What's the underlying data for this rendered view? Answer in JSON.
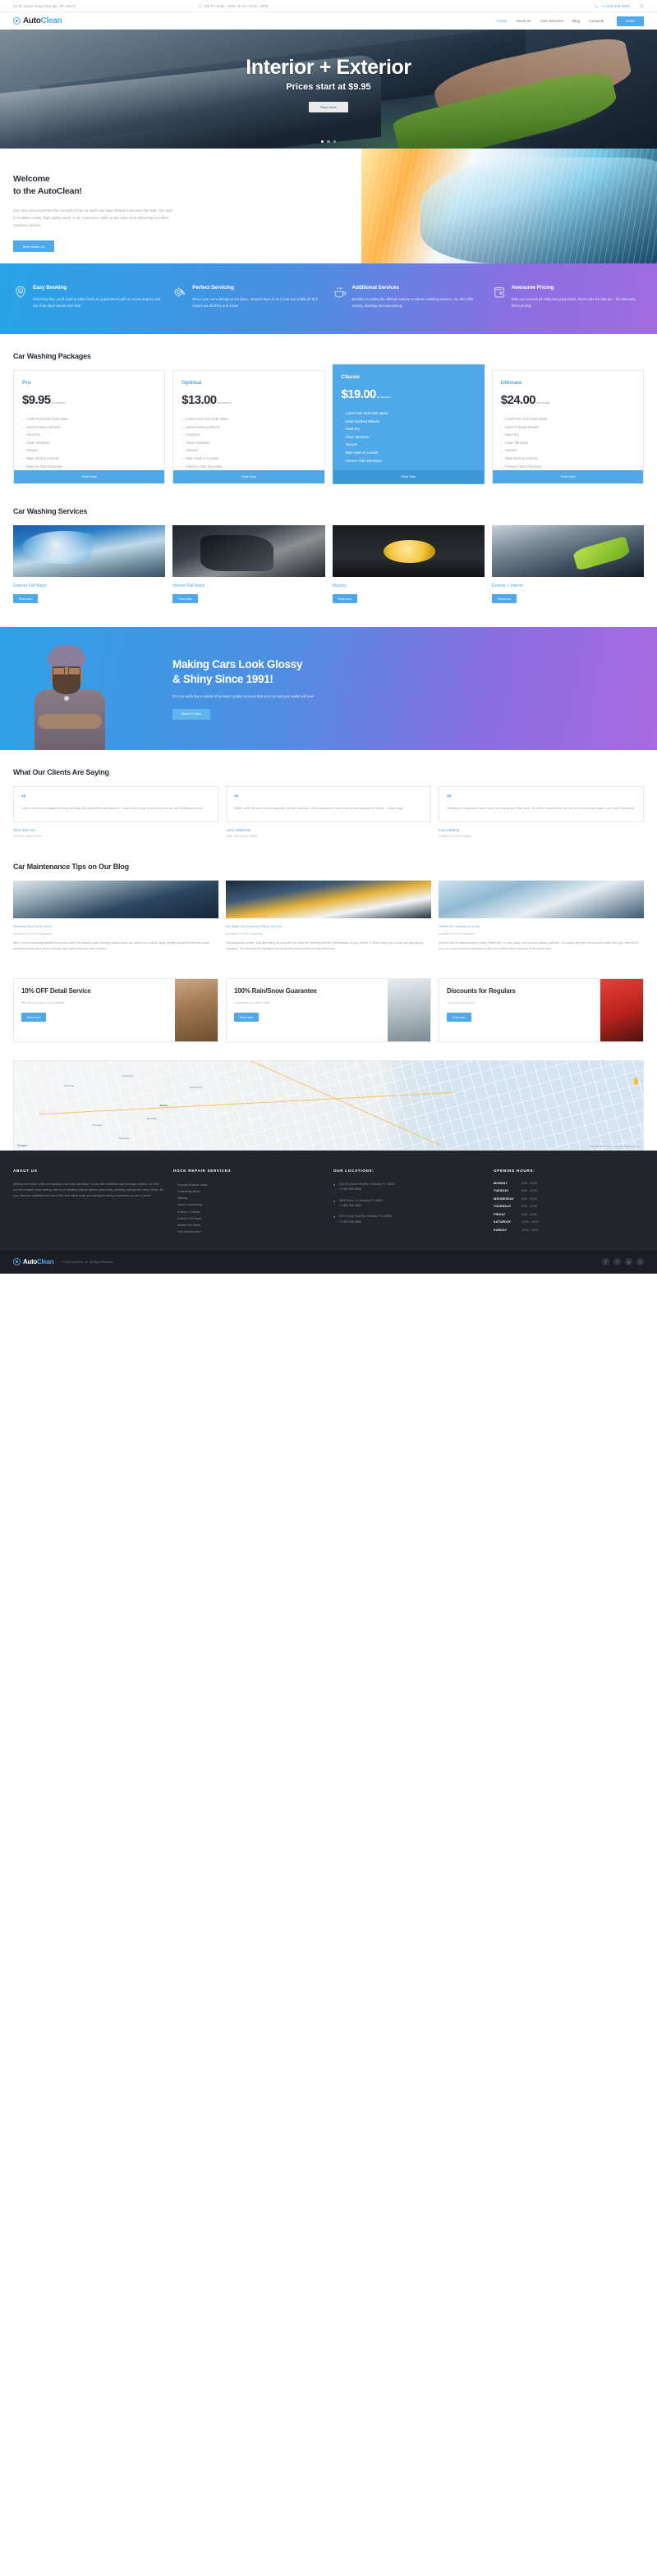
{
  "topbar": {
    "address": "22 St. Black Road Raleigh, PA 34578",
    "hours": "Mn-Fr: 6AM - 9PM, St-Sn: 6AM - 9PM",
    "phone": "+1 800 559 6580",
    "clock_icon": "clock-icon",
    "phone_icon": "phone-icon",
    "search_icon": "search-icon"
  },
  "header": {
    "logo_auto": "Auto",
    "logo_clean": "Clean",
    "nav": [
      {
        "label": "Home",
        "active": true
      },
      {
        "label": "About us",
        "active": false
      },
      {
        "label": "Auto Services",
        "active": false
      },
      {
        "label": "Blog",
        "active": false
      },
      {
        "label": "Contacts",
        "active": false
      }
    ],
    "cta": "Order"
  },
  "hero": {
    "title": "Interior + Exterior",
    "subtitle": "Prices start at $9.95",
    "button": "Read more",
    "slides": 3,
    "active_slide": 1
  },
  "welcome": {
    "title_line1": "Welcome",
    "title_line2": "to the AutoClean!",
    "body": "Our crew did not pioneer the concept of the car wash, we have strived to become the best. Our goal is to deliver a fast, high quality wash to our customers, while at the same time delivering excellent customer service.",
    "button": "More About Us"
  },
  "features": [
    {
      "icon": "map-pin-24-icon",
      "title": "Easy Booking",
      "text": "First thing first, you'll need to either book an appointment with us or just drop by and see if we have vacant time slot!"
    },
    {
      "icon": "gear-wrench-icon",
      "title": "Perfect Servicing",
      "text": "When your car's already at our place, all you'll have to do is just wait a little bit till it comes out all shiny and clean!"
    },
    {
      "icon": "coffee-cup-icon",
      "title": "Additional Services",
      "text": "Besides providing the ultimate exterior & interior washing services. we also offer waxing, detailing and vacuuming!"
    },
    {
      "icon": "wallet-icon",
      "title": "Awesome Pricing",
      "text": "With our services all really being top-notch, here's also the last joy – the ultimately finest pricing!"
    }
  ],
  "packages": {
    "title": "Car Washing Packages",
    "tax_note": "tax included",
    "order_label": "Order Now",
    "items": [
      {
        "name": "Pro",
        "price": "$9.95",
        "featured": false,
        "features": [
          "1,000-Point Soft Cloth Wash",
          "Hand-Finished Wheels",
          "Hand Dry",
          "Clean Windows",
          "Vacuum",
          "Wipe Dash & Console",
          "Febreze Odor Eliminator"
        ]
      },
      {
        "name": "Optimal",
        "price": "$13.00",
        "featured": false,
        "features": [
          "1,000-Point Soft Cloth Wash",
          "Hand-Finished Wheels",
          "Hand Dry",
          "Clean Windows",
          "Vacuum",
          "Wipe Dash & Console",
          "Febreze Odor Eliminator"
        ]
      },
      {
        "name": "Classic",
        "price": "$19.00",
        "featured": true,
        "features": [
          "1,000-Point Soft Cloth Wash",
          "Hand-Finished Wheels",
          "Hand Dry",
          "Clean Windows",
          "Vacuum",
          "Wipe Dash & Console",
          "Febreze Odor Eliminator"
        ]
      },
      {
        "name": "Ultimate",
        "price": "$24.00",
        "featured": false,
        "features": [
          "1,000-Point Soft Cloth Wash",
          "Hand-Finished Wheels",
          "Hand Dry",
          "Clean Windows",
          "Vacuum",
          "Wipe Dash & Console",
          "Febreze Odor Eliminator"
        ]
      }
    ]
  },
  "services": {
    "title": "Car Washing Services",
    "read_more": "Read more",
    "items": [
      {
        "name": "Exterior Full Wash"
      },
      {
        "name": "Interior Full Wash"
      },
      {
        "name": "Waxing"
      },
      {
        "name": "Exterior + Interior"
      }
    ]
  },
  "cta": {
    "title_line1": "Making Cars Look Glossy",
    "title_line2": "& Shiny Since 1991!",
    "text": "Our car wash has a variety of premium quality services that your car and your wallet will love!",
    "button": "Watch A Video"
  },
  "testimonials": {
    "title": "What Our Clients Are Saying",
    "quote_icon": "quote-icon",
    "items": [
      {
        "text": "I had in short my delegate all dusty and dirty. But each time that happens. I know where to go to make my ride an look drifting and clean.",
        "name": "John Stan Snn",
        "location": "new from united States"
      },
      {
        "text": "While I walk my cars exterior regularly, all have washed. I think someone to also clean up and vacuum its interior. - these guys!",
        "name": "Aaron Matthews",
        "location": "Hode, from United States"
      },
      {
        "text": "Showing me anywhere how to your car is what any other does. So when I want to take my car for a break and a wash, I go only to this place.",
        "name": "Karen Bishop",
        "location": "Florida from United States"
      }
    ]
  },
  "blog": {
    "title": "Car Maintenance Tips on Our Blog",
    "posts": [
      {
        "title": "Washing Your Car by Hand",
        "meta": "by admin  in  % 2016 It Comments",
        "text": "After a recent shocking rainfall that poured over the Atlantic coast, flooding makes some car owners do victims. Many people across the affected areas. Including drivers have driven through high water that may have caused..."
      },
      {
        "title": "Six Ways You Could be Killing Your Car",
        "meta": "by admin  in  % 2016 Comments",
        "text": "It is absolutely certain, that depending on how well you treat the steering and the maintenance of your vehicle, it either helps you or lose you figuratively speaking. The following list highlights six things that many drivers do that effectively..."
      },
      {
        "title": "\"Wash Me\" Writings on a Car",
        "meta": "by admin  in  % 2016 Comments",
        "text": "Anyone can tell that someone writing \"Wash Me\" on your dusty car's surface means just that - it is really dirty and needs some water then ago, this item if your car hasn't reached that stage of dirty yet, it feels rather cleaning of the inside and..."
      }
    ]
  },
  "offers": {
    "read_more": "Read more",
    "items": [
      {
        "title": "10% OFF Detail Service",
        "text": "With the purchase of a full package"
      },
      {
        "title": "100% Rain/Snow Guarantee",
        "text": "Guaranteed for a fresh wash!"
      },
      {
        "title": "Discounts for Regulars",
        "text": "Come and save today!"
      }
    ]
  },
  "map": {
    "logo": "Google",
    "credit": "Map data ©2016 Google   Terms of Use   Report a map error",
    "labels": [
      "Cambridge",
      "Boston",
      "Brookline",
      "Broadway",
      "Somerville",
      "Charlestown",
      "Back Bay"
    ],
    "pegman_icon": "pegman-icon"
  },
  "footer": {
    "about": {
      "heading": "ABOUT US",
      "text": "Making cars clean, shiny and glossy is our main specialty! On par with dedicated and thorough experts, we help you feel relaxed while waiting, with such detailing help as interior vacuuming, painting, waxing and many others. Be sure, that our establishment one of the best will to make you feel great riding a freshened up ride of yours!"
    },
    "services": {
      "heading": "ROCK REPAIR SERVICES",
      "items": [
        "Express Exterior Wash",
        "Underbody Wash",
        "Waxing",
        "Interior Vacuuming",
        "Exterior 1 Interior",
        "Exterior Full Wash",
        "Interior Full Wash",
        "Free Maintenance"
      ]
    },
    "locations": {
      "heading": "OUR LOCATIONS:",
      "pin_icon": "map-pin-icon",
      "items": [
        {
          "address": "411 W Church St #200, Orlando, FL 32802",
          "phone": "+1 800 559 6580"
        },
        {
          "address": "6625 Silver Ct, Orlando FL 32801",
          "phone": "+1 800 559 6580"
        },
        {
          "address": "4072 Curry Ford Rd, Orlando, FL 32806",
          "phone": "+1 800 559 6580"
        }
      ]
    },
    "hours": {
      "heading": "OPENING HOURS:",
      "rows": [
        {
          "day": "MONDAY",
          "time": "8:00 - 20:00"
        },
        {
          "day": "TUESDAY",
          "time": "8:00 - 20:00"
        },
        {
          "day": "WEDNESDAY",
          "time": "8:00 - 20:00"
        },
        {
          "day": "THURSDAY",
          "time": "8:00 - 20:00"
        },
        {
          "day": "FRIDAY",
          "time": "8:00 - 20:00"
        },
        {
          "day": "SATURDAY",
          "time": "10:00 - 18:00"
        },
        {
          "day": "SUNDAY",
          "time": "10:00 - 16:00"
        }
      ]
    }
  },
  "bottombar": {
    "logo_auto": "Auto",
    "logo_clean": "Clean",
    "copyright": "© 2016 AutoClean, Inc. All Rights Reserved.",
    "social": [
      {
        "icon": "facebook-icon",
        "glyph": "f"
      },
      {
        "icon": "twitter-icon",
        "glyph": "t"
      },
      {
        "icon": "google-plus-icon",
        "glyph": "g"
      },
      {
        "icon": "rss-icon",
        "glyph": "r"
      }
    ]
  },
  "colors": {
    "accent": "#4FA8E8",
    "dark": "#22252c",
    "purple": "#a06ce0"
  }
}
